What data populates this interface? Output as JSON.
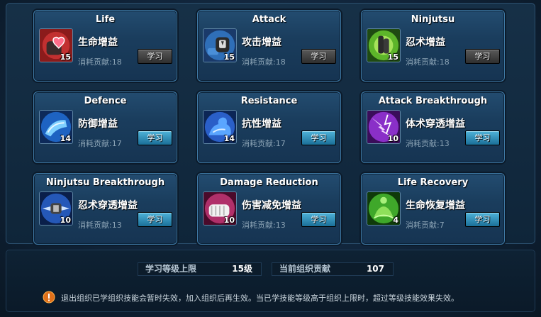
{
  "cards": [
    {
      "title": "Life",
      "name": "生命增益",
      "level": "15",
      "cost": "消耗贡献:18",
      "button": "学习",
      "icon": "life-heart-fist-icon"
    },
    {
      "title": "Attack",
      "name": "攻击增益",
      "level": "15",
      "cost": "消耗贡献:18",
      "button": "学习",
      "icon": "attack-fist-icon"
    },
    {
      "title": "Ninjutsu",
      "name": "忍术增益",
      "level": "15",
      "cost": "消耗贡献:18",
      "button": "学习",
      "icon": "ninjutsu-hand-sign-icon"
    },
    {
      "title": "Defence",
      "name": "防御增益",
      "level": "14",
      "cost": "消耗贡献:17",
      "button": "学习",
      "icon": "defence-arm-guard-icon"
    },
    {
      "title": "Resistance",
      "name": "抗性增益",
      "level": "14",
      "cost": "消耗贡献:17",
      "button": "学习",
      "icon": "resistance-flexed-arm-icon"
    },
    {
      "title": "Attack Breakthrough",
      "name": "体术穿透增益",
      "level": "10",
      "cost": "消耗贡献:13",
      "button": "学习",
      "icon": "attack-breakthrough-lightning-icon"
    },
    {
      "title": "Ninjutsu Breakthrough",
      "name": "忍术穿透增益",
      "level": "10",
      "cost": "消耗贡献:13",
      "button": "学习",
      "icon": "ninjutsu-breakthrough-hand-icon"
    },
    {
      "title": "Damage Reduction",
      "name": "伤害减免增益",
      "level": "10",
      "cost": "消耗贡献:13",
      "button": "学习",
      "icon": "damage-reduction-bandaged-fist-icon"
    },
    {
      "title": "Life Recovery",
      "name": "生命恢复增益",
      "level": "4",
      "cost": "消耗贡献:7",
      "button": "学习",
      "icon": "life-recovery-meditation-icon"
    }
  ],
  "stats": {
    "max_level_label": "学习等级上限",
    "max_level_value": "15级",
    "contribution_label": "当前组织贡献",
    "contribution_value": "107"
  },
  "notice": {
    "icon": "warning-icon",
    "text": "退出组织已学组织技能会暂时失效，加入组织后再生效。当已学技能等级高于组织上限时，超过等级技能效果失效。"
  },
  "colors": {
    "learn_disabled": "#4a4a4a",
    "learn_enabled": "#2a8cbf",
    "card_border": "#3f7aa6"
  }
}
